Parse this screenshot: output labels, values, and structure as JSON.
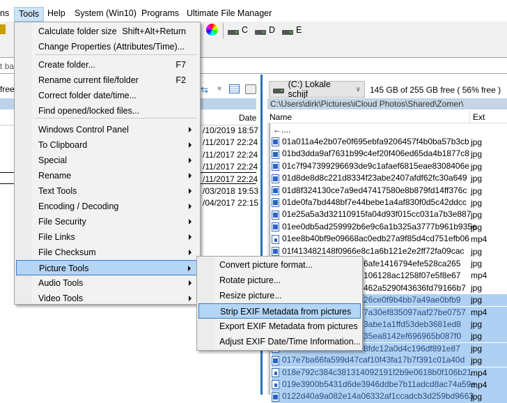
{
  "menubar": {
    "items": [
      "ns",
      "Tools",
      "Help",
      "System (Win10)",
      "Programs",
      "Ultimate File Manager"
    ]
  },
  "toolbar": {
    "drives": [
      "C",
      "D",
      "E"
    ]
  },
  "address": {
    "partial": "t ba"
  },
  "left_panel": {
    "free_partial": "free",
    "date_header": "Date",
    "dates": [
      "/10/2019 18:57",
      "/11/2017 22:24",
      "/11/2017 22:24",
      "/11/2017 22:24",
      "/11/2017 22:24",
      "/03/2018 19:53",
      "/04/2017 22:15"
    ]
  },
  "right_panel": {
    "drive": "(C:) Lokale schijf",
    "free": "145 GB of 255 GB free ( 56% free )",
    "path": "C:\\Users\\dirk\\Pictures\\iCloud Photos\\Shared\\Zomer\\",
    "col_name": "Name",
    "col_ext": "Ext",
    "back": "←....",
    "files": [
      {
        "name": "01a011a4e2b07e0f695ebfa9206457f4b0ba57b3cb",
        "ext": "jpg",
        "sel": false
      },
      {
        "name": "01bd3dda9af7631b99c4ef20f406ed65da4b1877c8",
        "ext": "jpg",
        "sel": false
      },
      {
        "name": "01c7f947399296693de9c1afaef6815eae8308406e",
        "ext": "jpg",
        "sel": false
      },
      {
        "name": "01d8de8d8c221d8334f23abe2407afdf62fc30a649",
        "ext": "jpg",
        "sel": false
      },
      {
        "name": "01d8f324130ce7a9ed47417580e8b879fd14ff376c",
        "ext": "jpg",
        "sel": false
      },
      {
        "name": "01de0fa7bd448bf7e44bebe1a4af830f0d5c42ddcc",
        "ext": "jpg",
        "sel": false
      },
      {
        "name": "01e25a5a3d32110915fa04d93f015cc031a7b3e887",
        "ext": "jpg",
        "sel": false
      },
      {
        "name": "01ee0db5ad259992b6e9c6a1b325a3777b961b935e",
        "ext": "jpg",
        "sel": false
      },
      {
        "name": "01ee8b40bf9e09668ac0edb27a9f85d4cd751efb06",
        "ext": "mp4",
        "sel": false
      },
      {
        "name": "01f413482148f0966e8c1a6b121e2e2ff72fa09cac",
        "ext": "jpg",
        "sel": false
      },
      {
        "name": "6afe1416794efe528ca265",
        "ext": "jpg",
        "sel": false,
        "partial": true
      },
      {
        "name": "106128ac1258f07e5f8e67",
        "ext": "mp4",
        "sel": false,
        "partial": true
      },
      {
        "name": "462a5290f43636fd79166b7",
        "ext": "jpg",
        "sel": false,
        "partial": true
      },
      {
        "name": "26ce0f9b4bb7a49ae0bfb9",
        "ext": "jpg",
        "sel": true,
        "partial": true
      },
      {
        "name": "7a30ef835097aaf27be0757",
        "ext": "mp4",
        "sel": true,
        "partial": true
      },
      {
        "name": "3abe1a1ffd53deb3681ed8",
        "ext": "jpg",
        "sel": true,
        "partial": true
      },
      {
        "name": "35ea8142ef696965b087f0",
        "ext": "jpg",
        "sel": true,
        "partial": true
      },
      {
        "name": "8fdc12a0d4c196df891e87",
        "ext": "jpg",
        "sel": true,
        "partial": true
      },
      {
        "name": "017e7ba66fa599d47caf10f43fa17b7f391c01a40d",
        "ext": "jpg",
        "sel": true
      },
      {
        "name": "018e792c384c381314092191f2b9e0618b0f106b21",
        "ext": "mp4",
        "sel": true
      },
      {
        "name": "019e3900b5431d6de3946ddbe7b11adcd8ac74a59e",
        "ext": "mp4",
        "sel": true
      },
      {
        "name": "0122d40a9a082e14a06332af1ccadcb3d259bd9663",
        "ext": "jpg",
        "sel": true
      }
    ]
  },
  "tools_menu": {
    "items": [
      {
        "label": "Calculate folder size",
        "shortcut": "Shift+Alt+Return"
      },
      {
        "label": "Change Properties (Attributes/Time)..."
      },
      {
        "label": "Create folder...",
        "shortcut": "F7"
      },
      {
        "label": "Rename current file/folder",
        "shortcut": "F2"
      },
      {
        "label": "Correct folder date/time..."
      },
      {
        "label": "Find opened/locked files..."
      },
      {
        "label": "Windows Control Panel",
        "sub": true
      },
      {
        "label": "To Clipboard",
        "sub": true
      },
      {
        "label": "Special",
        "sub": true
      },
      {
        "label": "Rename",
        "sub": true
      },
      {
        "label": "Text Tools",
        "sub": true
      },
      {
        "label": "Encoding / Decoding",
        "sub": true
      },
      {
        "label": "File Security",
        "sub": true
      },
      {
        "label": "File Links",
        "sub": true
      },
      {
        "label": "File Checksum",
        "sub": true
      },
      {
        "label": "Picture Tools",
        "sub": true
      },
      {
        "label": "Audio Tools",
        "sub": true
      },
      {
        "label": "Video Tools",
        "sub": true
      }
    ]
  },
  "picture_submenu": {
    "items": [
      "Convert picture format...",
      "Rotate picture...",
      "Resize picture...",
      "Strip EXIF Metadata from pictures",
      "Export EXIF Metadata from pictures",
      "Adjust EXIF Date/Time Information..."
    ]
  }
}
